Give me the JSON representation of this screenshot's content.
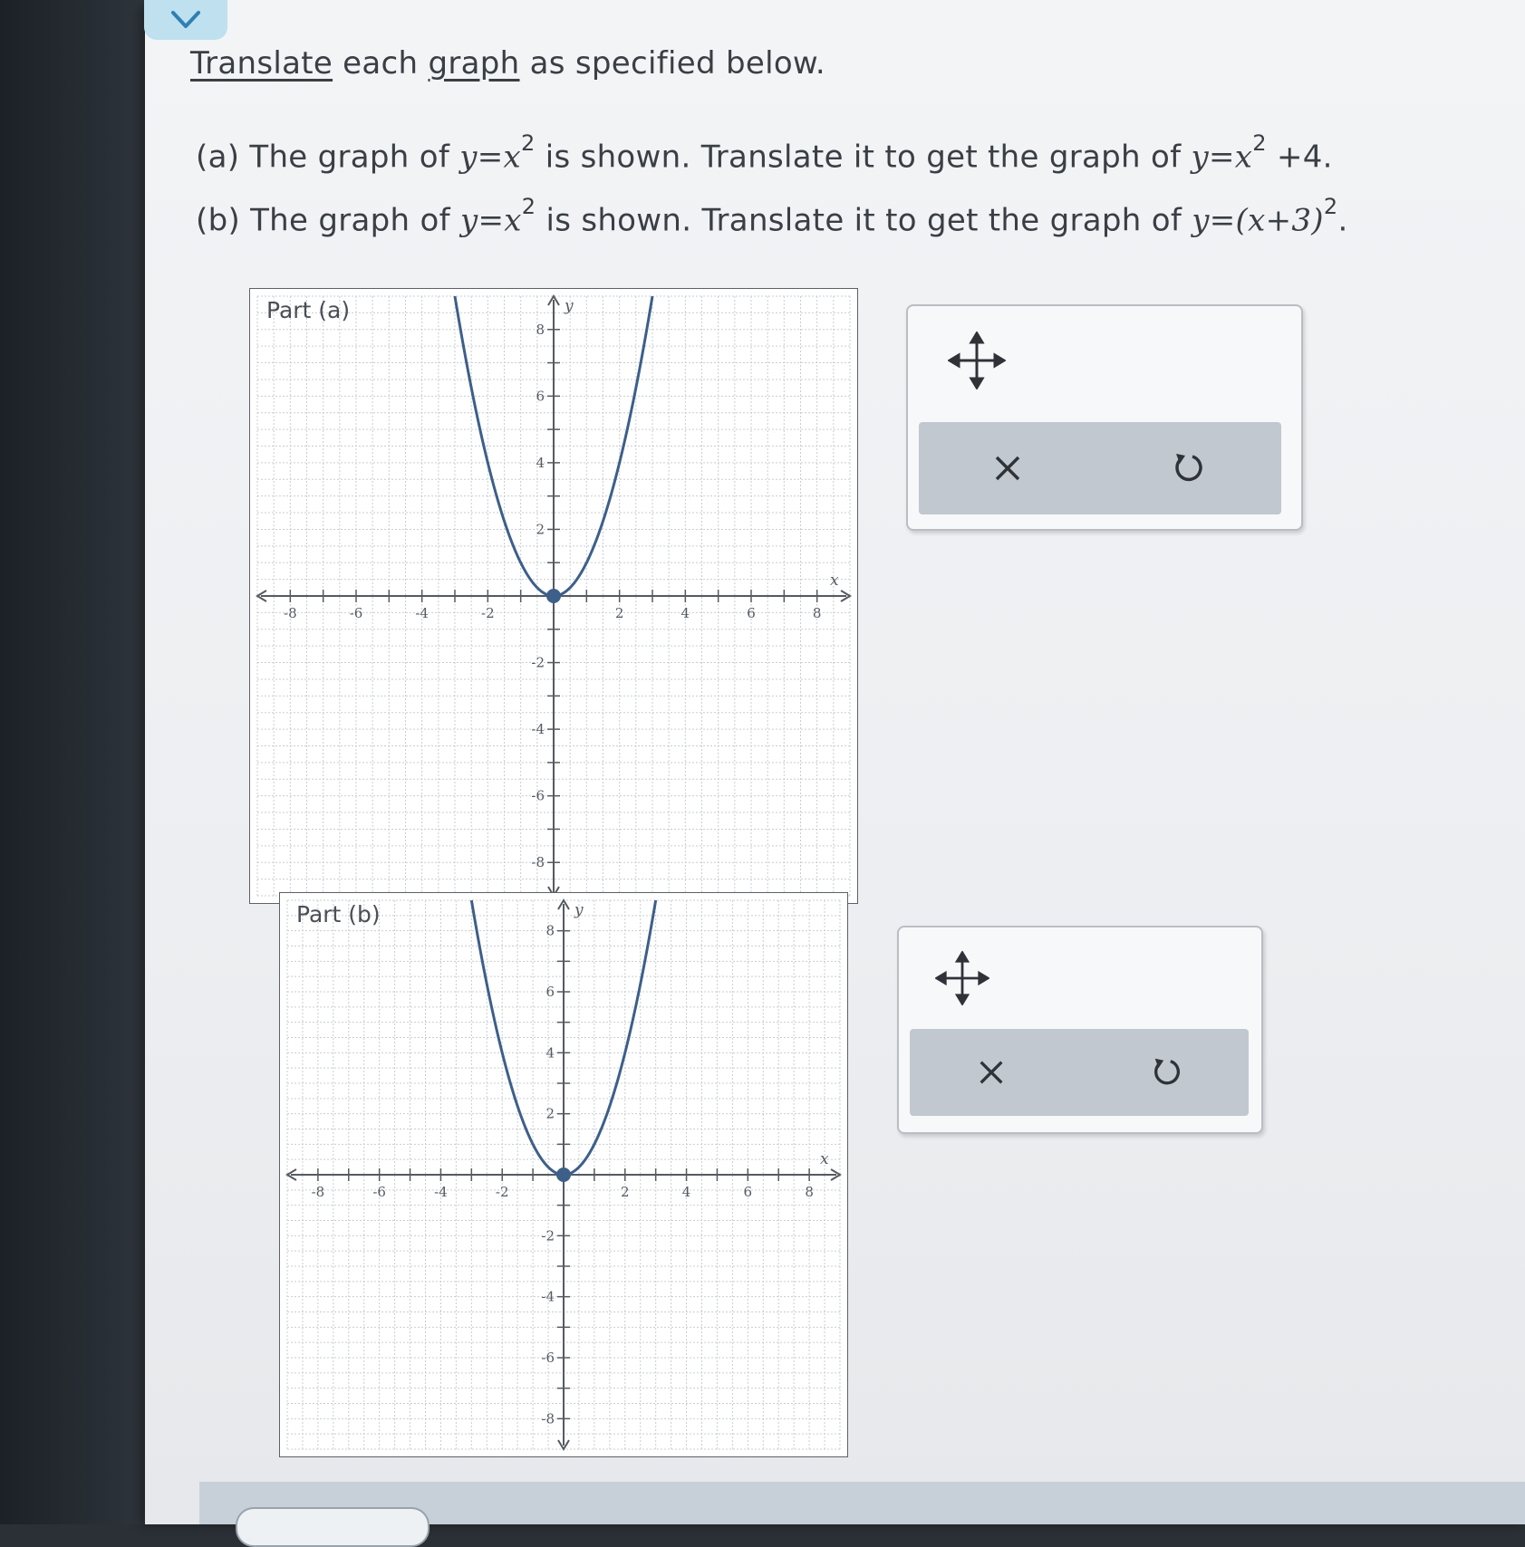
{
  "instruction": {
    "prefix": "",
    "link1": "Translate",
    "mid": " each ",
    "link2": "graph",
    "suffix": " as specified below."
  },
  "part_a": {
    "lead": "(a) The graph of ",
    "shown_eq": "y=x",
    "shown_exp": "2",
    "middle": " is shown. Translate it to get the graph of ",
    "target_eq": "y=x",
    "target_exp": "2",
    "target_tail": " +4."
  },
  "part_b": {
    "lead": "(b) The graph of ",
    "shown_eq": "y=x",
    "shown_exp": "2",
    "middle": " is shown. Translate it to get the graph of ",
    "target_eq": "y=(x+3)",
    "target_exp": "2",
    "target_tail": "."
  },
  "colors": {
    "curve": "#3d5f8a",
    "grid": "#c9cdd2",
    "axis": "#555a60",
    "button_bar": "#c2c8cf"
  },
  "icons": {
    "top": "chevron-down-icon",
    "move": "move-arrows-icon",
    "clear": "close-icon",
    "undo": "undo-icon"
  },
  "chart_data": [
    {
      "type": "line",
      "title": "Part (a)",
      "xlabel": "x",
      "ylabel": "y",
      "xlim": [
        -9,
        9
      ],
      "ylim": [
        -9,
        9
      ],
      "grid": true,
      "x_ticks": [
        -8,
        -6,
        -4,
        -2,
        2,
        4,
        6,
        8
      ],
      "y_ticks": [
        8,
        6,
        4,
        2,
        -2,
        -4,
        -6,
        -8
      ],
      "series": [
        {
          "function": "y = x^2",
          "x": [
            -3,
            -2,
            -1,
            0,
            1,
            2,
            3
          ],
          "y": [
            9,
            4,
            1,
            0,
            1,
            4,
            9
          ],
          "vertex": [
            0,
            0
          ]
        }
      ]
    },
    {
      "type": "line",
      "title": "Part (b)",
      "xlabel": "x",
      "ylabel": "y",
      "xlim": [
        -9,
        9
      ],
      "ylim": [
        -9,
        9
      ],
      "grid": true,
      "x_ticks": [
        -8,
        -6,
        -4,
        -2,
        2,
        4,
        6,
        8
      ],
      "y_ticks": [
        8,
        6,
        4,
        2,
        -2,
        -4,
        -6,
        -8
      ],
      "series": [
        {
          "function": "y = x^2",
          "x": [
            -3,
            -2,
            -1,
            0,
            1,
            2,
            3
          ],
          "y": [
            9,
            4,
            1,
            0,
            1,
            4,
            9
          ],
          "vertex": [
            0,
            0
          ]
        }
      ]
    }
  ]
}
